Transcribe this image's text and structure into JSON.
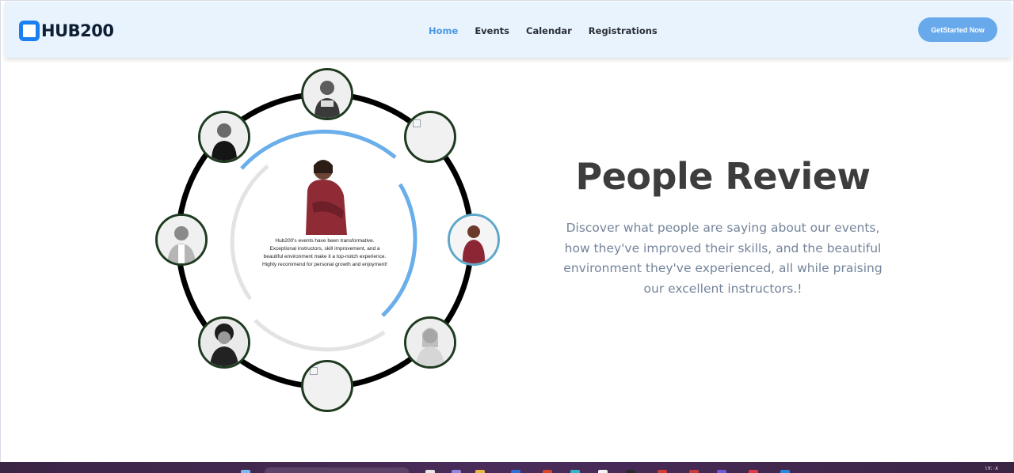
{
  "brand": {
    "name": "HUB200"
  },
  "nav": {
    "items": [
      {
        "label": "Home",
        "active": true
      },
      {
        "label": "Events",
        "active": false
      },
      {
        "label": "Calendar",
        "active": false
      },
      {
        "label": "Registrations",
        "active": false
      }
    ],
    "cta_label": "GetStarted Now"
  },
  "review": {
    "quote": "Hub200's events have been transformative. Exceptional instructors, skill improvement, and a beautiful environment make it a top-notch experience. Highly recommend for personal growth and enjoyment!",
    "reviewers": [
      "top",
      "top-right",
      "right",
      "bottom-right",
      "bottom",
      "bottom-left",
      "left",
      "top-left"
    ],
    "active_reviewer": "right"
  },
  "section": {
    "title": "People Review",
    "description": "Discover what people are saying about our events, how they've improved their skills, and the beautiful environment they've experienced, all while praising our excellent instructors.!"
  },
  "taskbar": {
    "clock": "١٧:٠٨"
  },
  "colors": {
    "accent": "#4a98e6",
    "cta": "#68a9ec",
    "header_bg": "#e8f3fd",
    "ring": "#000000",
    "arc_blue": "#6aaeea",
    "arc_grey": "#e3e3e3",
    "avatar_border": "#1e3a1f"
  }
}
